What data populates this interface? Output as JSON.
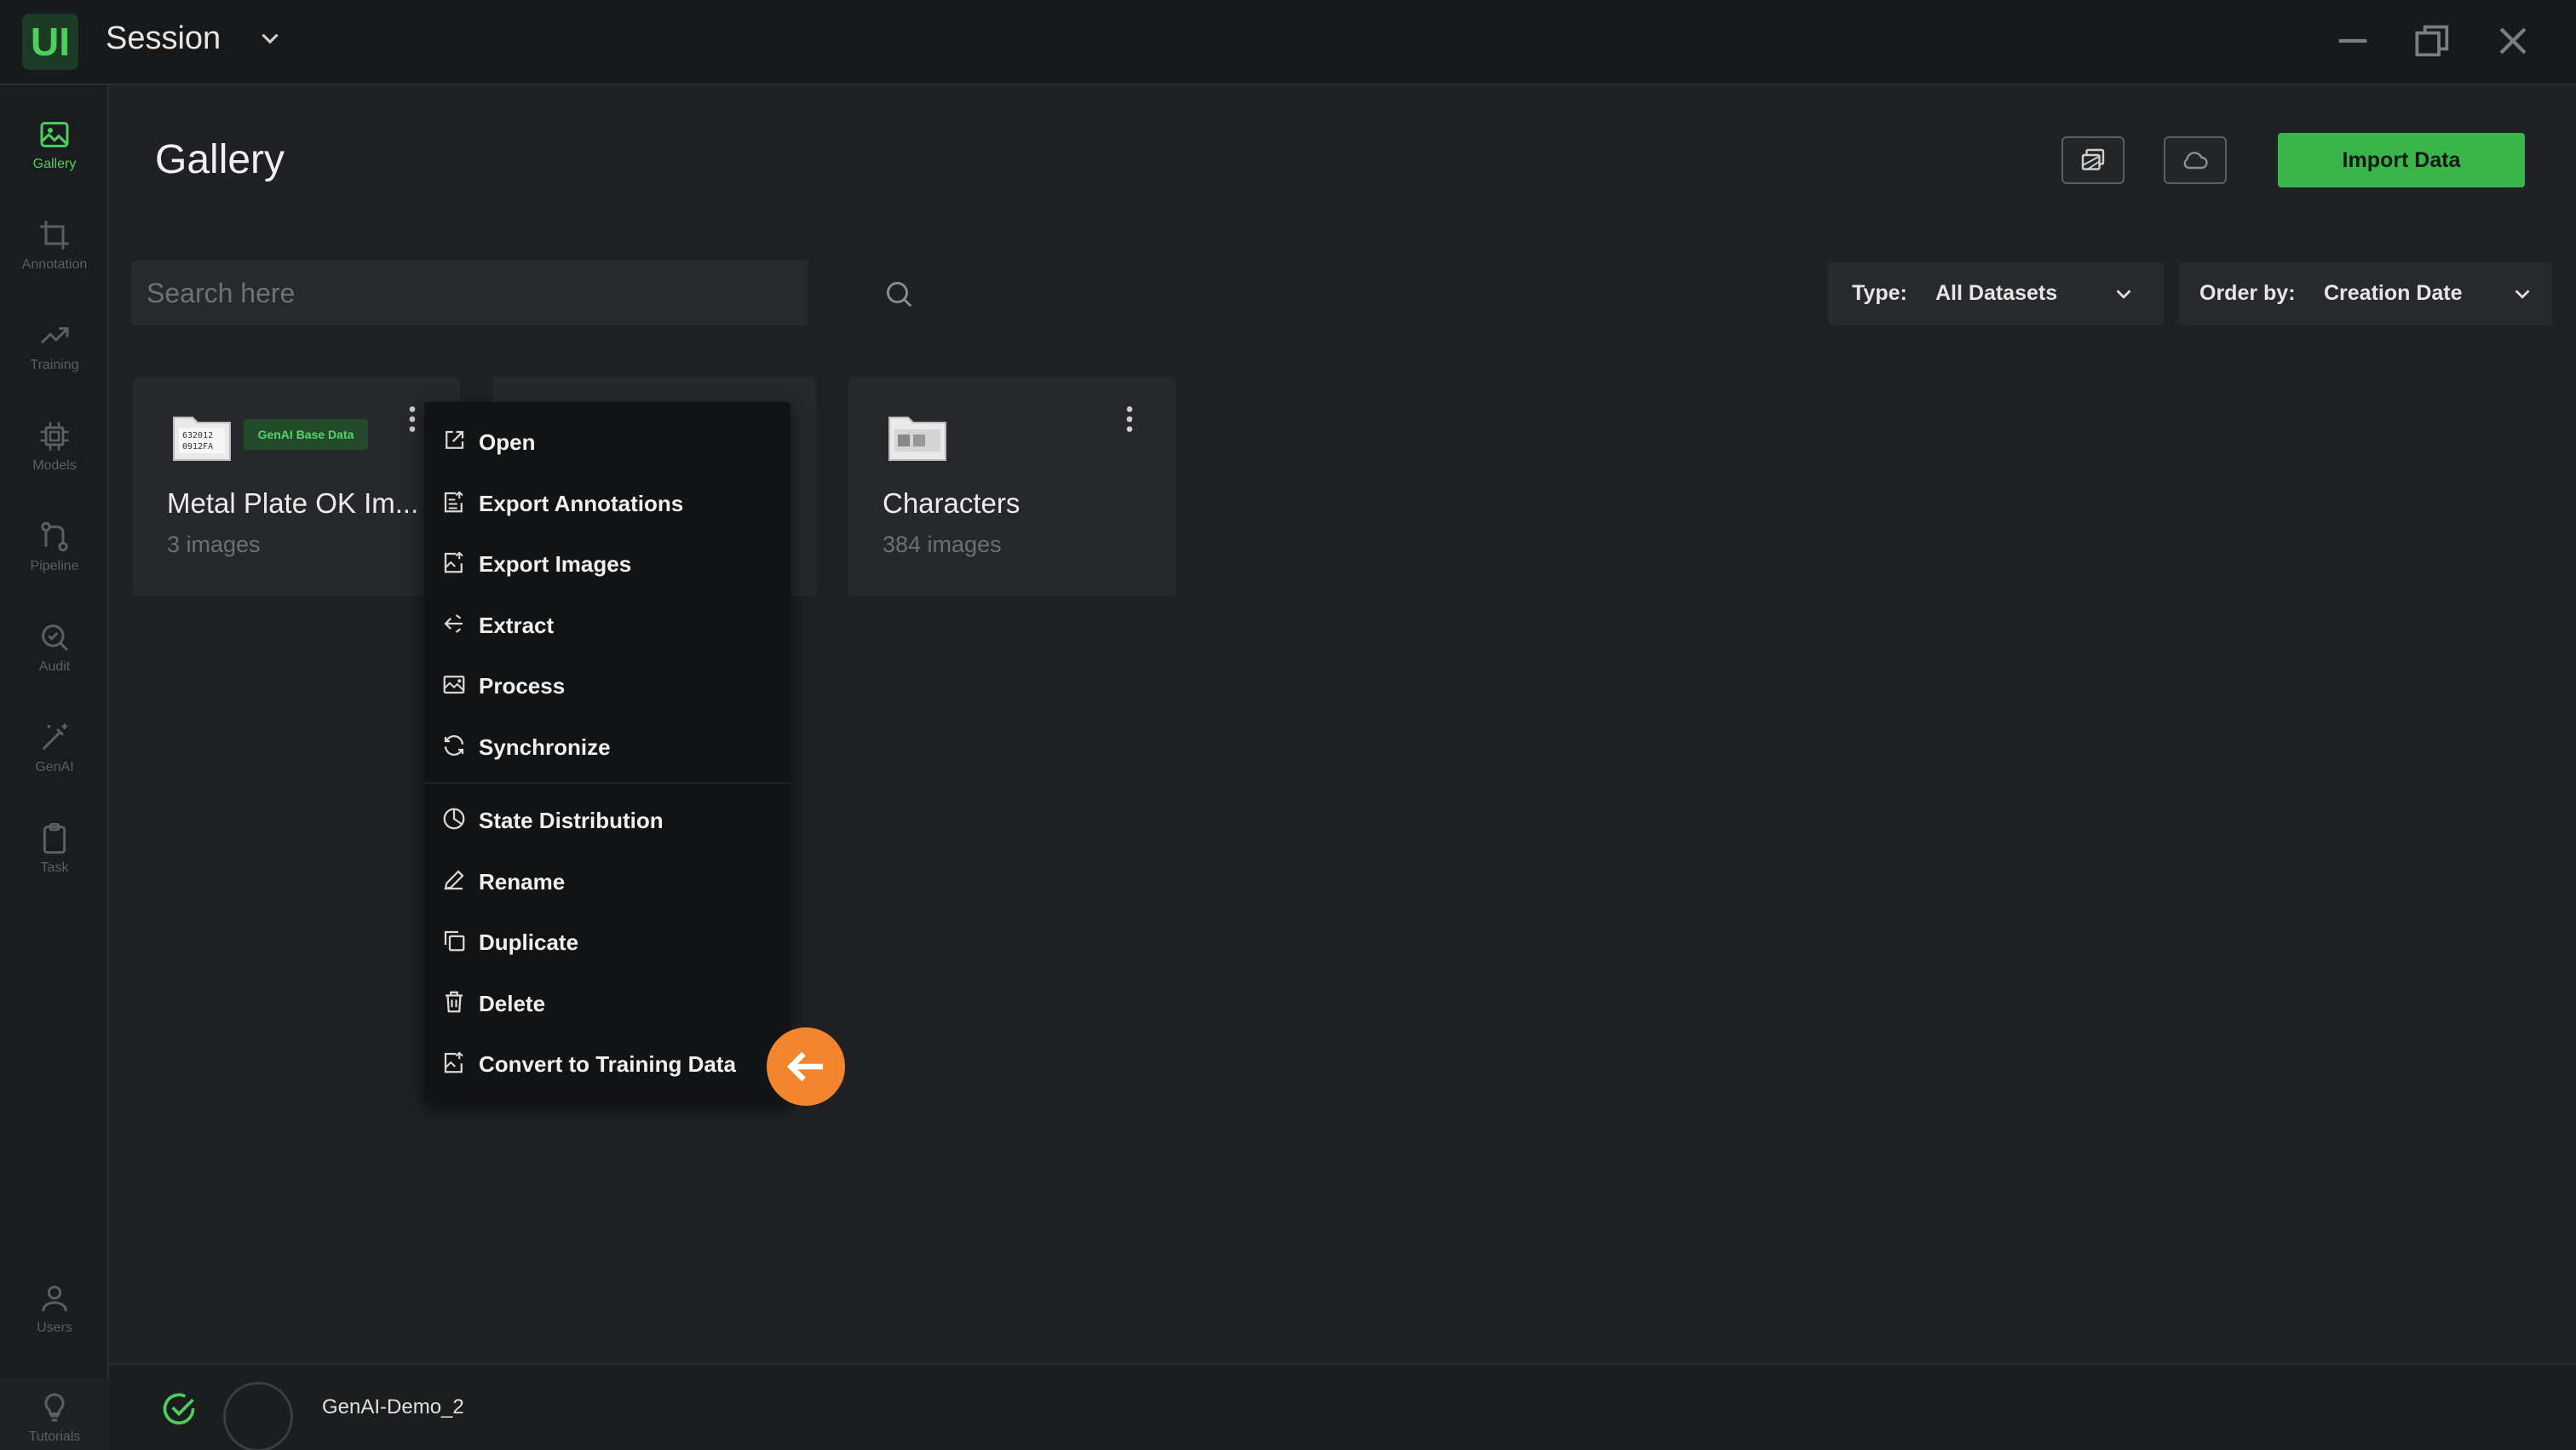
{
  "app": {
    "logo_text": "UI",
    "session_title": "Session"
  },
  "sidebar": {
    "items": [
      {
        "label": "Gallery",
        "icon": "image-icon",
        "active": true
      },
      {
        "label": "Annotation",
        "icon": "crop-icon"
      },
      {
        "label": "Training",
        "icon": "trend-icon"
      },
      {
        "label": "Models",
        "icon": "chip-icon"
      },
      {
        "label": "Pipeline",
        "icon": "pipeline-icon"
      },
      {
        "label": "Audit",
        "icon": "audit-icon"
      },
      {
        "label": "GenAI",
        "icon": "magic-wand-icon"
      },
      {
        "label": "Task",
        "icon": "clipboard-icon"
      },
      {
        "label": "Users",
        "icon": "user-icon"
      },
      {
        "label": "Tutorials",
        "icon": "lightbulb-icon"
      }
    ]
  },
  "main": {
    "title": "Gallery",
    "import_label": "Import Data",
    "search_placeholder": "Search here",
    "filters": {
      "type_label": "Type:",
      "type_value": "All Datasets",
      "order_label": "Order by:",
      "order_value": "Creation Date"
    }
  },
  "datasets": [
    {
      "name": "Metal Plate OK Im...",
      "count": "3 images",
      "badge": "GenAI Base Data"
    },
    {
      "name": "Characters",
      "count": "384 images"
    }
  ],
  "context_menu": {
    "items": [
      {
        "label": "Open",
        "icon": "open-external-icon"
      },
      {
        "label": "Export Annotations",
        "icon": "export-annotations-icon"
      },
      {
        "label": "Export Images",
        "icon": "export-images-icon"
      },
      {
        "label": "Extract",
        "icon": "extract-icon"
      },
      {
        "label": "Process",
        "icon": "process-icon"
      },
      {
        "label": "Synchronize",
        "icon": "sync-icon"
      },
      {
        "label": "State Distribution",
        "icon": "pie-chart-icon"
      },
      {
        "label": "Rename",
        "icon": "pencil-icon"
      },
      {
        "label": "Duplicate",
        "icon": "duplicate-icon"
      },
      {
        "label": "Delete",
        "icon": "trash-icon"
      },
      {
        "label": "Convert to Training Data",
        "icon": "convert-icon"
      }
    ]
  },
  "status": {
    "project_name": "GenAI-Demo_2"
  },
  "colors": {
    "accent": "#3ab54a",
    "pointer": "#f2852e",
    "background": "#1f2124"
  }
}
